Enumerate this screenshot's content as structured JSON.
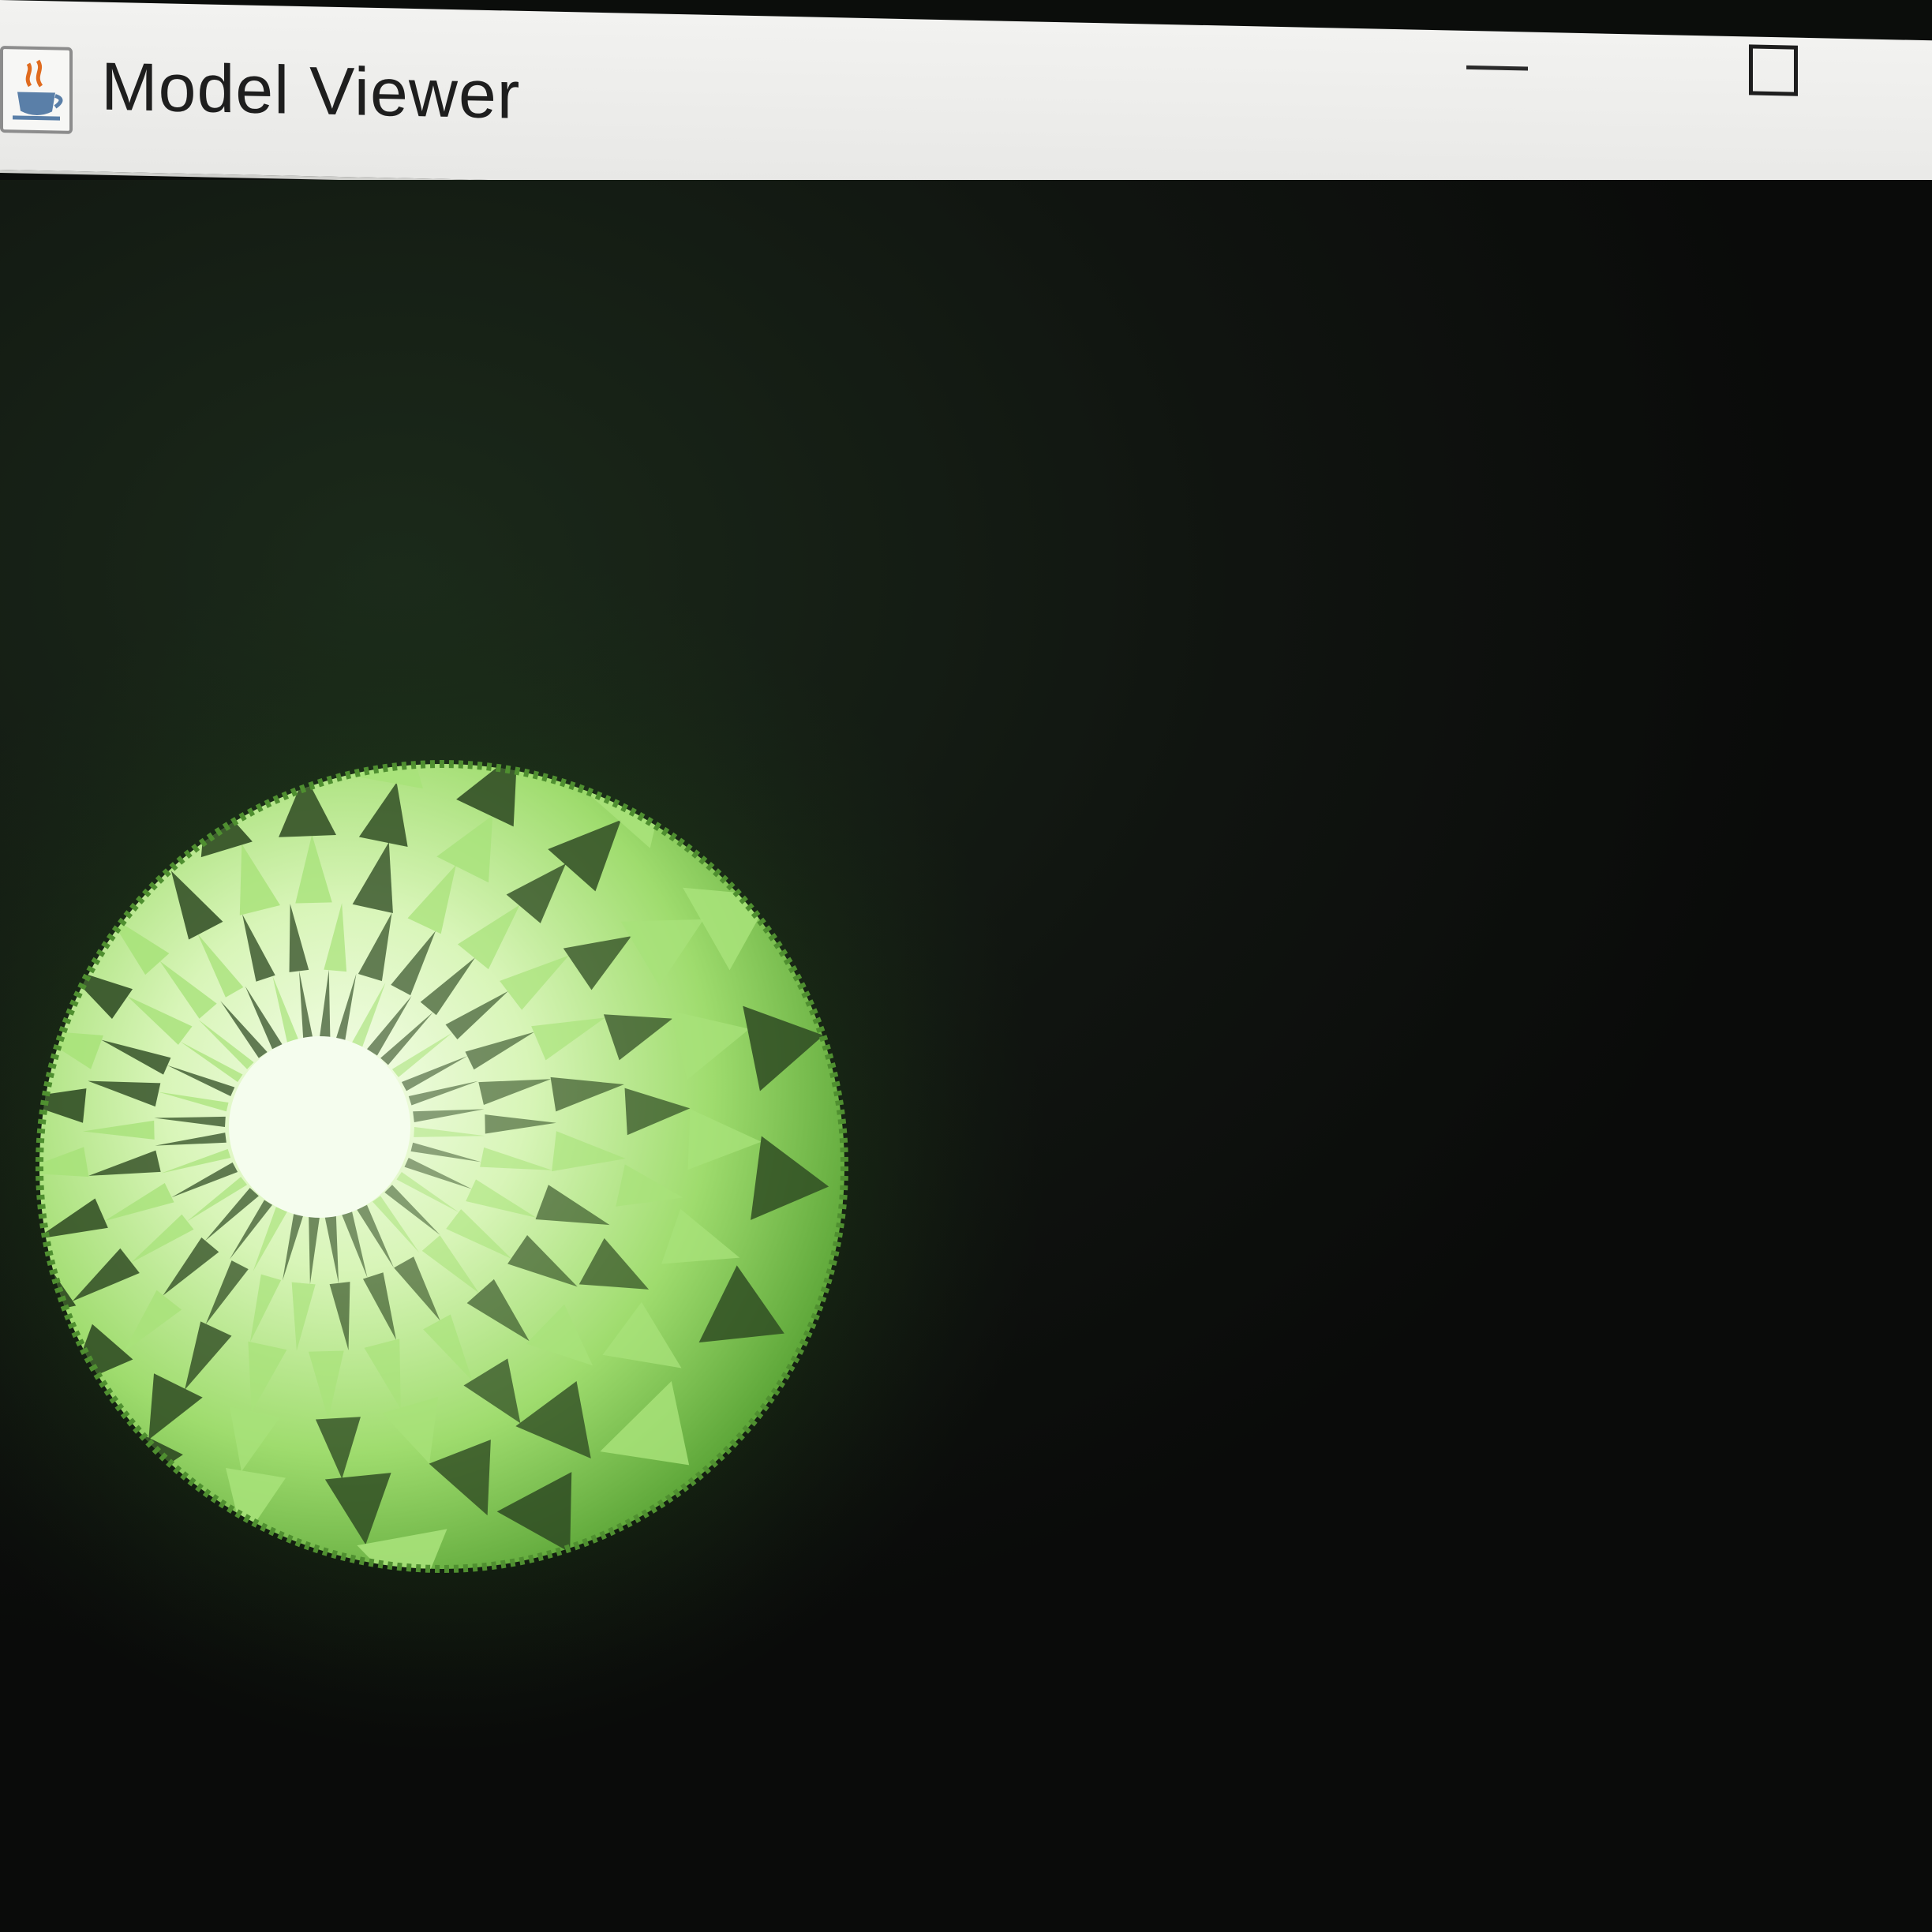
{
  "window": {
    "title": "Model Viewer",
    "icon": "java-cup-icon",
    "controls": [
      "minimize-icon",
      "maximize-icon"
    ]
  },
  "viewport": {
    "background_color": "#0b0d0b",
    "model": {
      "shape": "faceted-sphere",
      "color_light": "#f1fbe2",
      "color_mid": "#a8e27a",
      "color_dark": "#2e4a22"
    }
  }
}
